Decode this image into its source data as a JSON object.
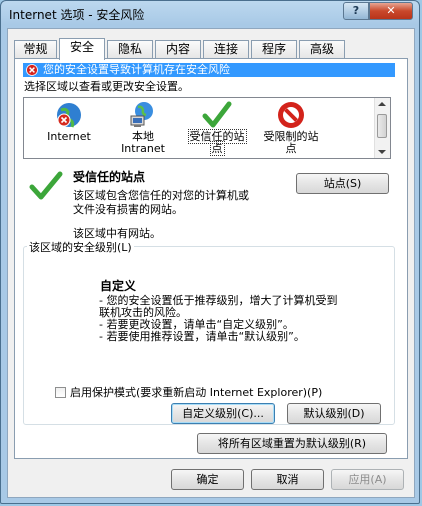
{
  "window": {
    "title": "Internet 选项 - 安全风险",
    "help_label": "?",
    "close_label": "✕"
  },
  "tabs": [
    {
      "label": "常规"
    },
    {
      "label": "安全"
    },
    {
      "label": "隐私"
    },
    {
      "label": "内容"
    },
    {
      "label": "连接"
    },
    {
      "label": "程序"
    },
    {
      "label": "高级"
    }
  ],
  "active_tab": "安全",
  "warning": {
    "text": "您的安全设置导致计算机存在安全风险",
    "icon": "shield-x-icon"
  },
  "zone_prompt": "选择区域以查看或更改安全设置。",
  "zones": [
    {
      "label_line1": "Internet",
      "label_line2": "",
      "icon": "globe-blocked-icon"
    },
    {
      "label_line1": "本地",
      "label_line2": "Intranet",
      "icon": "intranet-icon"
    },
    {
      "label_line1": "受信任的站",
      "label_line2": "点",
      "icon": "check-icon",
      "selected": true
    },
    {
      "label_line1": "受限制的站",
      "label_line2": "点",
      "icon": "restricted-icon"
    }
  ],
  "selected_zone": {
    "title": "受信任的站点",
    "desc_line1": "该区域包含您信任的对您的计算机或",
    "desc_line2": "文件没有损害的网站。",
    "note": "该区域中有网站。"
  },
  "sites_button": "站点(S)",
  "security_level": {
    "legend": "该区域的安全级别(L)",
    "title": "自定义",
    "lines": [
      "- 您的安全设置低于推荐级别，增大了计算机受到",
      "联机攻击的风险。",
      "- 若要更改设置，请单击“自定义级别”。",
      "- 若要使用推荐设置，请单击“默认级别”。"
    ]
  },
  "protected_mode": {
    "label": "启用保护模式(要求重新启动 Internet Explorer)(P)",
    "checked": false
  },
  "buttons": {
    "custom_level": "自定义级别(C)...",
    "default_level": "默认级别(D)",
    "reset_all": "将所有区域重置为默认级别(R)",
    "ok": "确定",
    "cancel": "取消",
    "apply": "应用(A)"
  },
  "colors": {
    "selection": "#3399ff",
    "title_bar": "#a8c9e6",
    "close": "#c9482b"
  }
}
